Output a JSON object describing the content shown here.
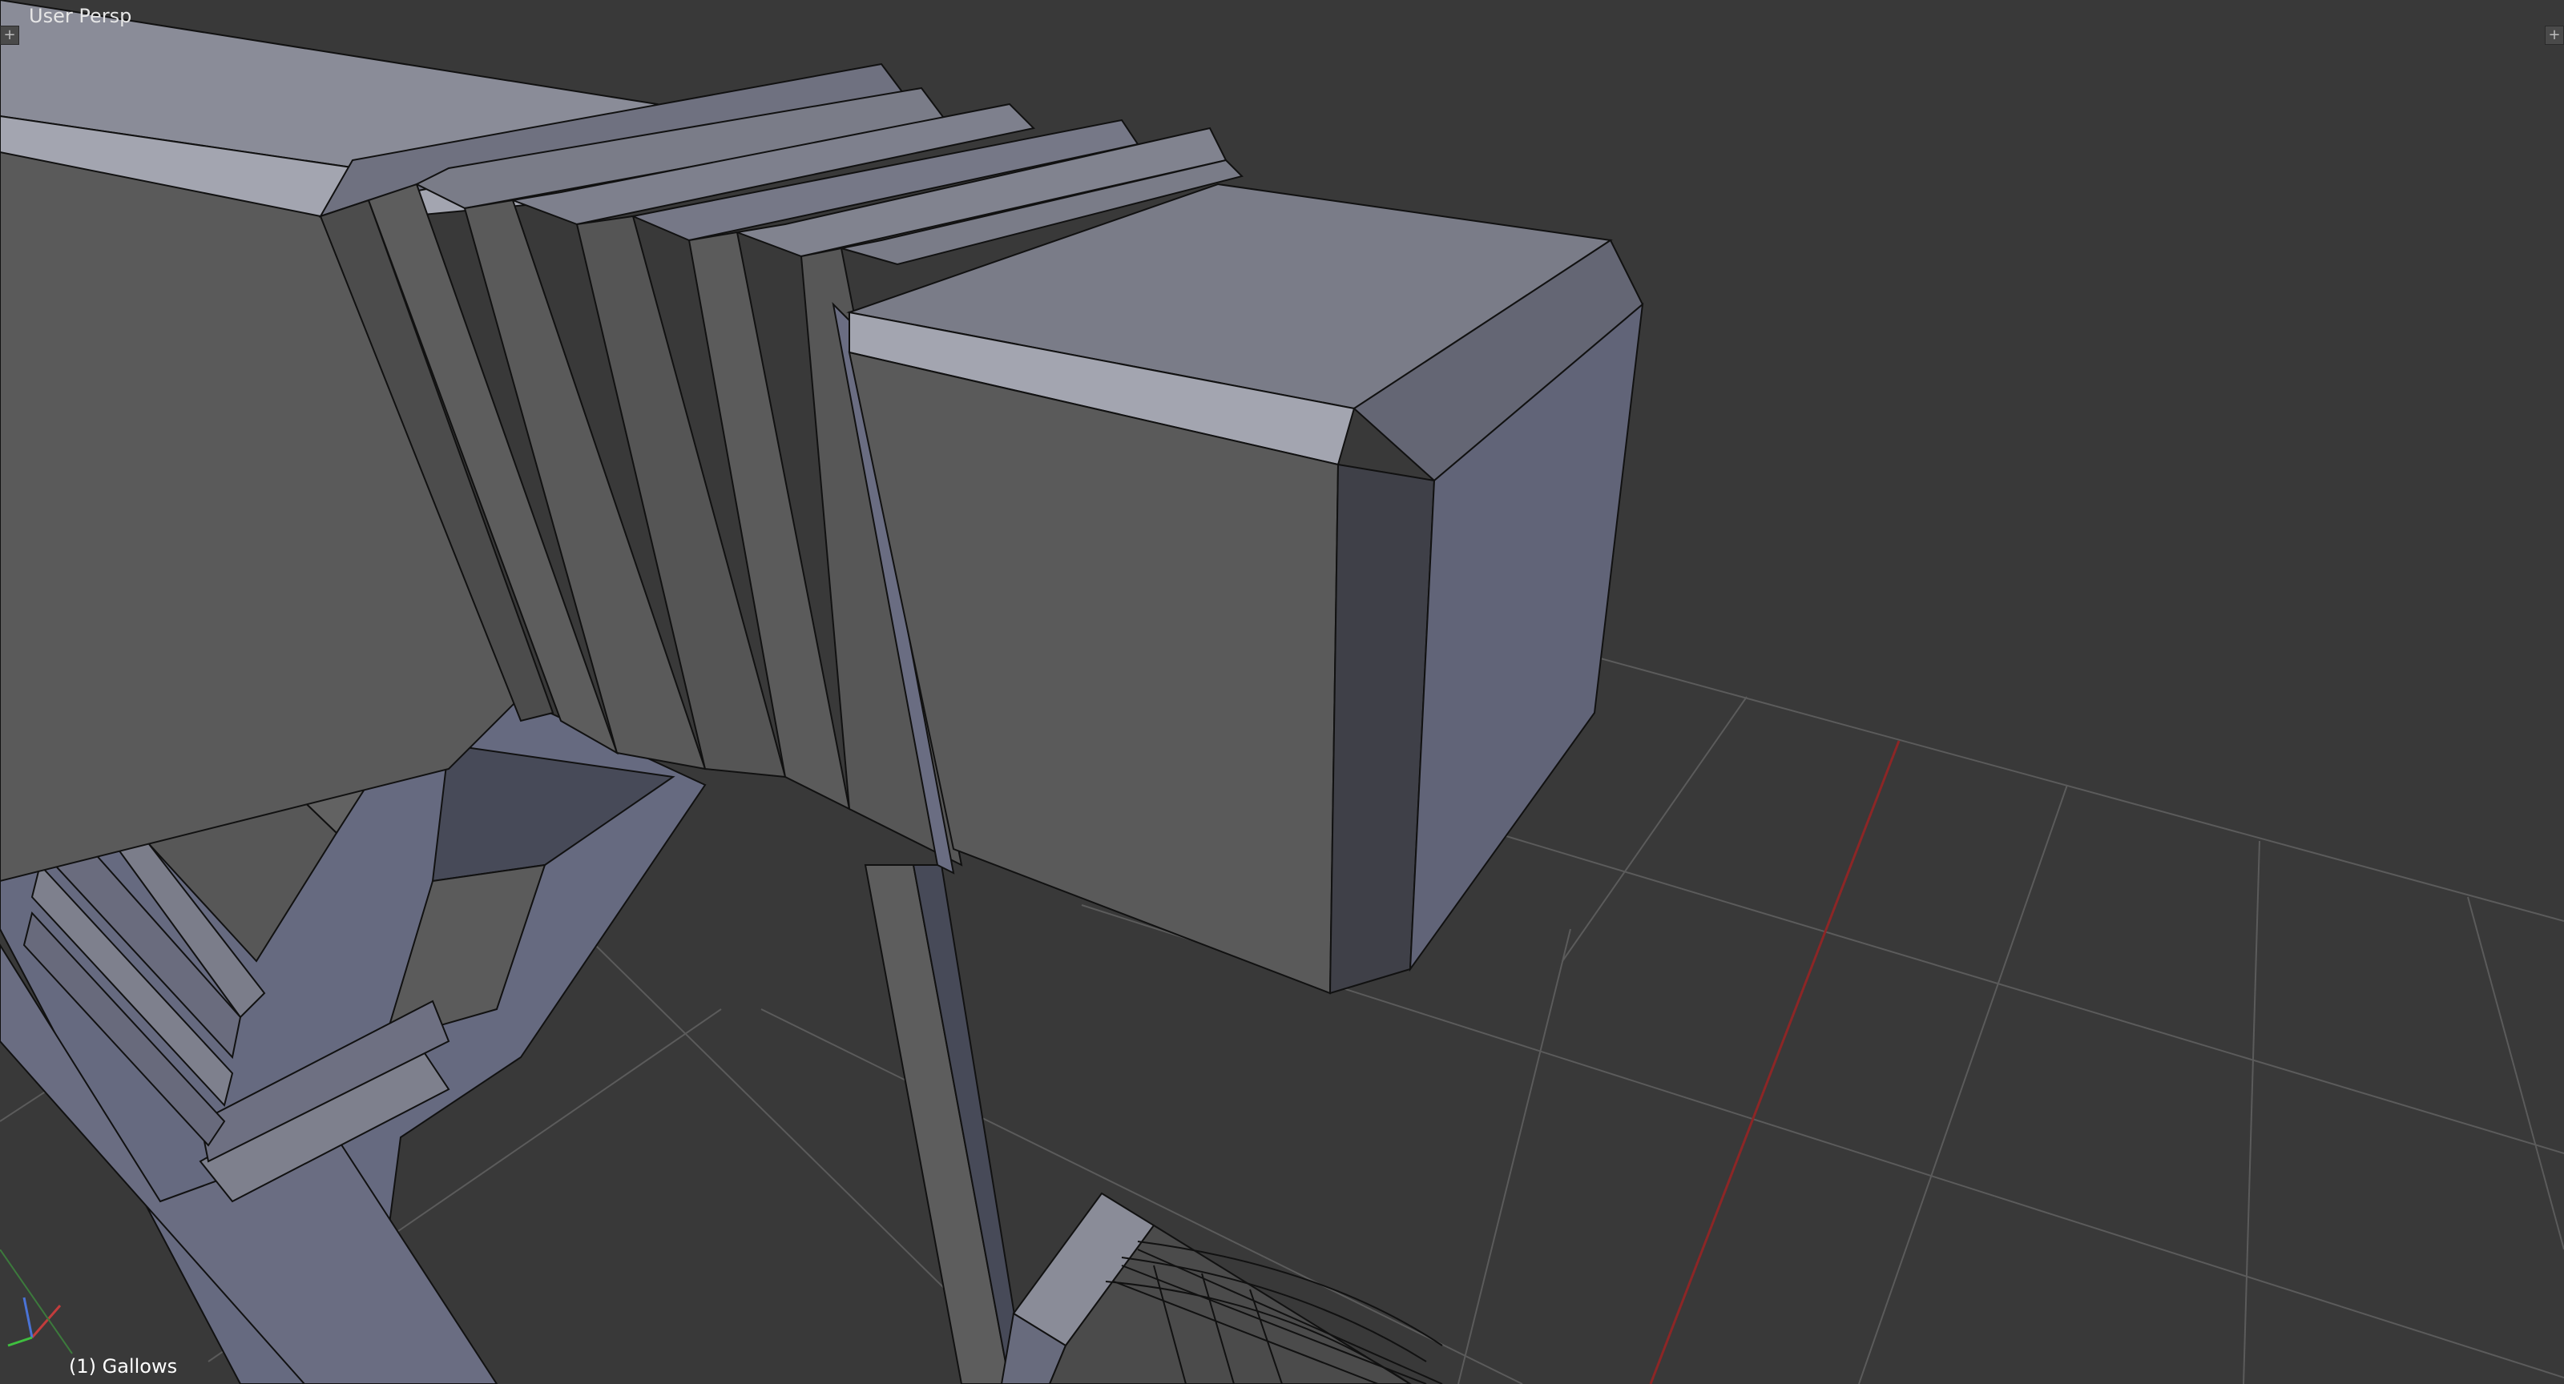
{
  "viewport": {
    "view_name": "User Persp",
    "object_label": "(1) Gallows",
    "corner_widget_symbol": "+"
  },
  "colors": {
    "background": "#393939",
    "grid_line": "#595959",
    "x_axis": "#8c2626",
    "mesh_top": "#7a7c88",
    "mesh_front": "#5a5a5a",
    "mesh_side": "#616478",
    "mesh_edge": "#111111"
  },
  "icons": {
    "corner_widget": "viewport-split-handle",
    "axis": "axis-gizmo-icon"
  }
}
